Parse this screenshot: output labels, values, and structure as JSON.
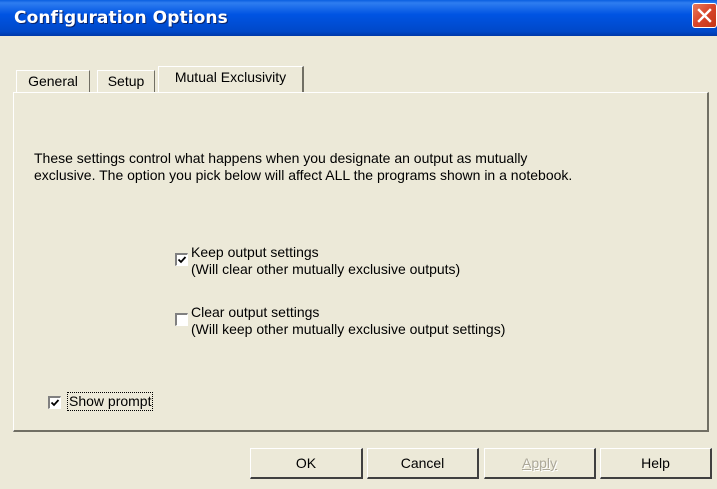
{
  "window": {
    "title": "Configuration Options"
  },
  "tabs": [
    {
      "label": "General",
      "active": false
    },
    {
      "label": "Setup",
      "active": false
    },
    {
      "label": "Mutual Exclusivity",
      "active": true
    }
  ],
  "description": {
    "line1": "These settings control what happens when you designate an output as mutually",
    "line2": "exclusive. The option you pick below will affect ALL the programs shown in a notebook."
  },
  "options": {
    "keep": {
      "checked": true,
      "title": "Keep output settings",
      "detail": "(Will clear other mutually exclusive outputs)"
    },
    "clear": {
      "checked": false,
      "title": "Clear output settings",
      "detail": "(Will keep other mutually exclusive output settings)"
    }
  },
  "show_prompt": {
    "checked": true,
    "label": "Show prompt"
  },
  "buttons": {
    "ok": "OK",
    "cancel": "Cancel",
    "apply": "Apply",
    "help": "Help"
  },
  "colors": {
    "title_bar": "#0054e3",
    "dialog_bg": "#ece9d8",
    "close_button": "#d8442a"
  }
}
